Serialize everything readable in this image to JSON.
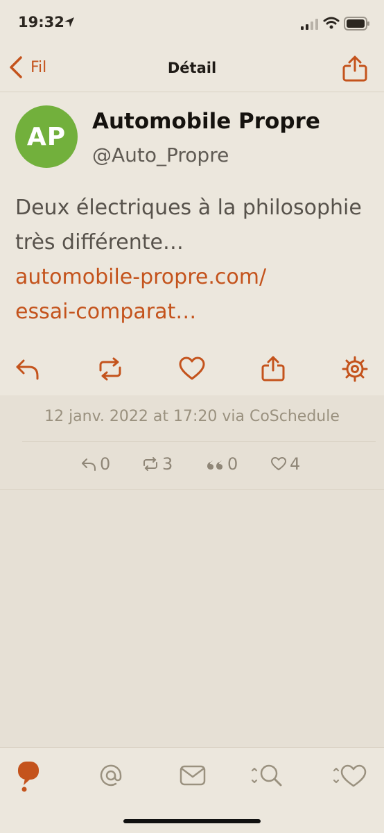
{
  "status_bar": {
    "time": "19:32"
  },
  "nav": {
    "back_label": "Fil",
    "title": "Détail"
  },
  "tweet": {
    "avatar_initials": "AP",
    "avatar_color": "#72b03c",
    "name": "Automobile Propre",
    "handle": "@Auto_Propre",
    "text": "Deux électriques à la philosophie très différente…",
    "link_line1": "automobile-propre.com/",
    "link_line2": "essai-comparat…"
  },
  "actions": [
    "reply-icon",
    "retweet-icon",
    "heart-icon",
    "share-icon",
    "gear-icon"
  ],
  "meta": {
    "date": "12 janv. 2022 at 17:20 via CoSchedule",
    "replies": "0",
    "retweets": "3",
    "quotes": "0",
    "likes": "4"
  },
  "tabs": [
    "timeline-bubble-icon",
    "mentions-at-icon",
    "messages-envelope-icon",
    "search-icon",
    "favorites-heart-icon"
  ],
  "colors": {
    "accent": "#c4531c",
    "background": "#e6e0d5",
    "panel": "#ece7dd",
    "muted": "#9a917f"
  }
}
